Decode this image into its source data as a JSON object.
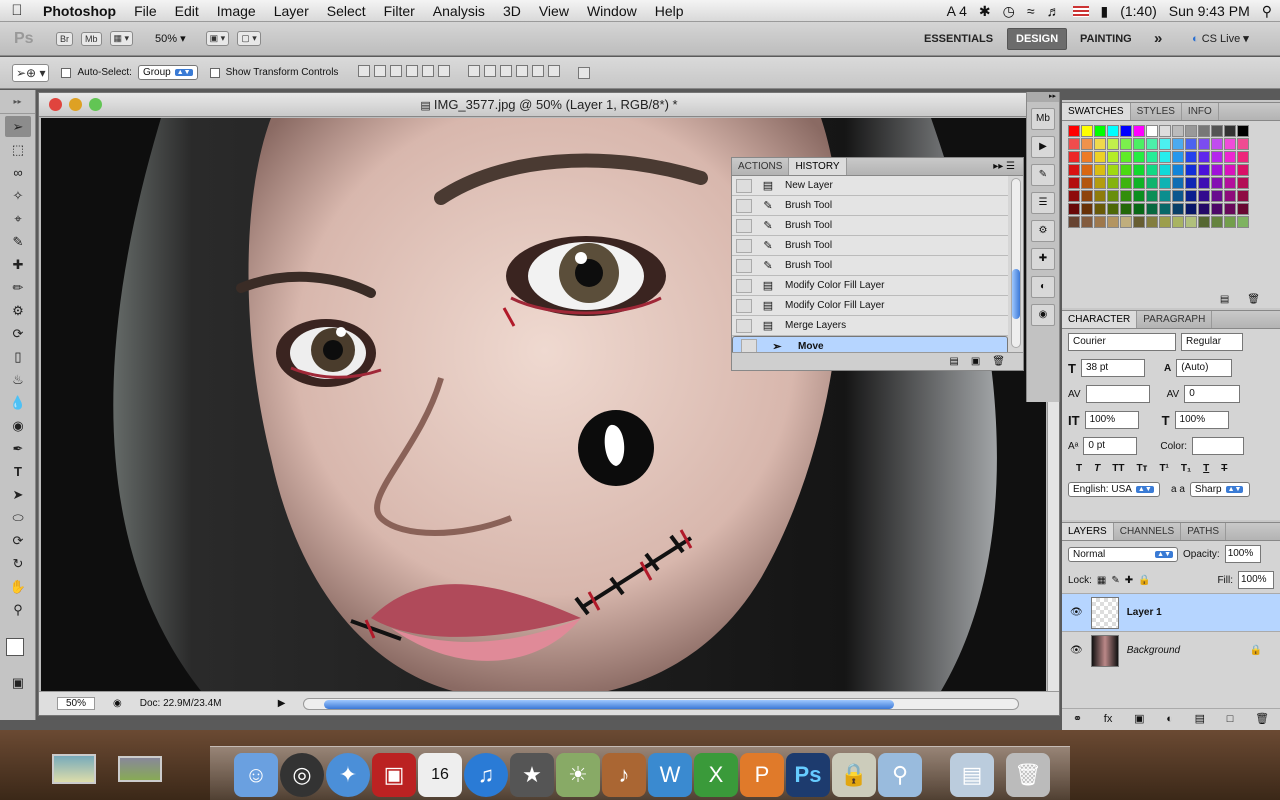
{
  "menubar": {
    "apple": "",
    "app": "Photoshop",
    "items": [
      "File",
      "Edit",
      "Image",
      "Layer",
      "Select",
      "Filter",
      "Analysis",
      "3D",
      "View",
      "Window",
      "Help"
    ],
    "status": {
      "ai": "4",
      "battery": "(1:40)",
      "clock": "Sun 9:43 PM"
    }
  },
  "appbar": {
    "logo": "Ps",
    "br": "Br",
    "mb": "Mb",
    "zoom": "50%",
    "workspaces": [
      "ESSENTIALS",
      "DESIGN",
      "PAINTING"
    ],
    "more": "»",
    "cslive": "CS Live"
  },
  "options": {
    "autoselect": "Auto-Select:",
    "group": "Group",
    "transform": "Show Transform Controls"
  },
  "document": {
    "title": "IMG_3577.jpg @ 50% (Layer 1, RGB/8*) *",
    "zoom": "50%",
    "doc": "Doc: 22.9M/23.4M"
  },
  "history": {
    "tabs": [
      "ACTIONS",
      "HISTORY"
    ],
    "items": [
      {
        "icon": "doc-icon",
        "label": "New Layer"
      },
      {
        "icon": "brush-icon",
        "label": "Brush Tool"
      },
      {
        "icon": "brush-icon",
        "label": "Brush Tool"
      },
      {
        "icon": "brush-icon",
        "label": "Brush Tool"
      },
      {
        "icon": "brush-icon",
        "label": "Brush Tool"
      },
      {
        "icon": "doc-icon",
        "label": "Modify Color Fill Layer"
      },
      {
        "icon": "doc-icon",
        "label": "Modify Color Fill Layer"
      },
      {
        "icon": "doc-icon",
        "label": "Merge Layers"
      },
      {
        "icon": "move-icon",
        "label": "Move"
      }
    ]
  },
  "swatches": {
    "tabs": [
      "SWATCHES",
      "STYLES",
      "INFO"
    ]
  },
  "character": {
    "tabs": [
      "CHARACTER",
      "PARAGRAPH"
    ],
    "font": "Courier",
    "style": "Regular",
    "size": "38 pt",
    "leading": "(Auto)",
    "tracking": "0",
    "vscale": "100%",
    "hscale": "100%",
    "baseline": "0 pt",
    "color_label": "Color:",
    "language": "English: USA",
    "aa_label": "a a",
    "aa": "Sharp"
  },
  "layers": {
    "tabs": [
      "LAYERS",
      "CHANNELS",
      "PATHS"
    ],
    "blend": "Normal",
    "opacity_label": "Opacity:",
    "opacity": "100%",
    "lock_label": "Lock:",
    "fill_label": "Fill:",
    "fill": "100%",
    "items": [
      "Layer 1",
      "Background"
    ]
  }
}
